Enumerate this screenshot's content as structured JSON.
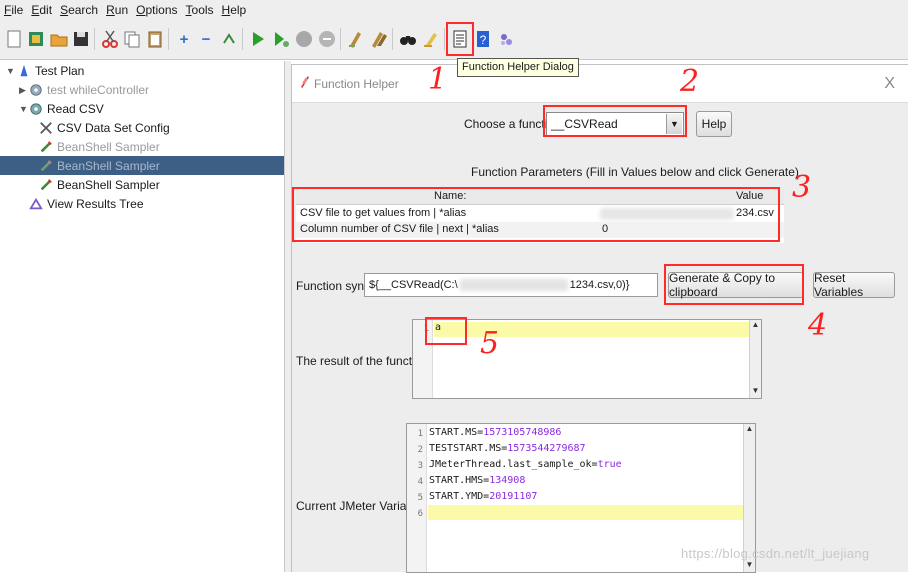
{
  "menu": [
    {
      "label": "File",
      "mn": "F",
      "rest": "ile"
    },
    {
      "label": "Edit",
      "mn": "E",
      "rest": "dit"
    },
    {
      "label": "Search",
      "mn": "S",
      "rest": "earch"
    },
    {
      "label": "Run",
      "mn": "R",
      "rest": "un"
    },
    {
      "label": "Options",
      "mn": "O",
      "rest": "ptions"
    },
    {
      "label": "Tools",
      "mn": "T",
      "rest": "ools"
    },
    {
      "label": "Help",
      "mn": "H",
      "rest": "elp"
    }
  ],
  "toolbar": {
    "tooltip": "Function Helper Dialog",
    "icons": [
      "new-icon",
      "templates-icon",
      "open-icon",
      "save-icon",
      "cut-icon",
      "copy-icon",
      "paste-icon",
      "expand-icon",
      "collapse-icon",
      "toggle-icon",
      "start-icon",
      "start-no-pauses-icon",
      "stop-icon",
      "shutdown-icon",
      "clear-icon",
      "clear-all-icon",
      "search-icon",
      "reset-search-icon",
      "function-helper-icon",
      "help-icon",
      "log-viewer-icon"
    ]
  },
  "tree": {
    "items": [
      {
        "label": "Test Plan",
        "icon": "test-plan-icon"
      },
      {
        "label": "test whileController",
        "icon": "controller-icon"
      },
      {
        "label": "Read CSV",
        "icon": "thread-group-icon"
      },
      {
        "label": "CSV Data Set Config",
        "icon": "config-icon"
      },
      {
        "label": "BeanShell Sampler",
        "icon": "sampler-icon"
      },
      {
        "label": "BeanShell Sampler",
        "icon": "sampler-icon"
      },
      {
        "label": "BeanShell Sampler",
        "icon": "sampler-icon"
      },
      {
        "label": "View Results Tree",
        "icon": "listener-icon"
      }
    ]
  },
  "dialog": {
    "title": "Function Helper",
    "close": "X",
    "choose_label": "Choose a function",
    "selected_function": "__CSVRead",
    "help_button": "Help",
    "params_heading": "Function Parameters (Fill in Values below and click Generate)",
    "table": {
      "headers": [
        "Name:",
        "Value"
      ],
      "rows": [
        {
          "name": "CSV file to get values from | *alias",
          "value": "234.csv"
        },
        {
          "name": "Column number of CSV file | next | *alias",
          "value": "0"
        }
      ]
    },
    "syntax_label": "Function syntax:",
    "syntax_value_start": "${__CSVRead(C:\\",
    "syntax_value_end": "1234.csv,0)}",
    "generate_button": "Generate & Copy to clipboard",
    "reset_button": "Reset Variables",
    "result_label": "The result of the function is",
    "result_lines": [
      "a"
    ],
    "variables_label": "Current JMeter Variables",
    "variables": [
      {
        "key": "START.MS=",
        "val": "1573105748986"
      },
      {
        "key": "TESTSTART.MS=",
        "val": "1573544279687"
      },
      {
        "key": "JMeterThread.last_sample_ok=",
        "val": "true"
      },
      {
        "key": "START.HMS=",
        "val": "134908"
      },
      {
        "key": "START.YMD=",
        "val": "20191107"
      },
      {
        "key": "",
        "val": ""
      }
    ]
  },
  "annotations": [
    "1",
    "2",
    "3",
    "4",
    "5"
  ],
  "watermark": "https://blog.csdn.net/lt_juejiang"
}
